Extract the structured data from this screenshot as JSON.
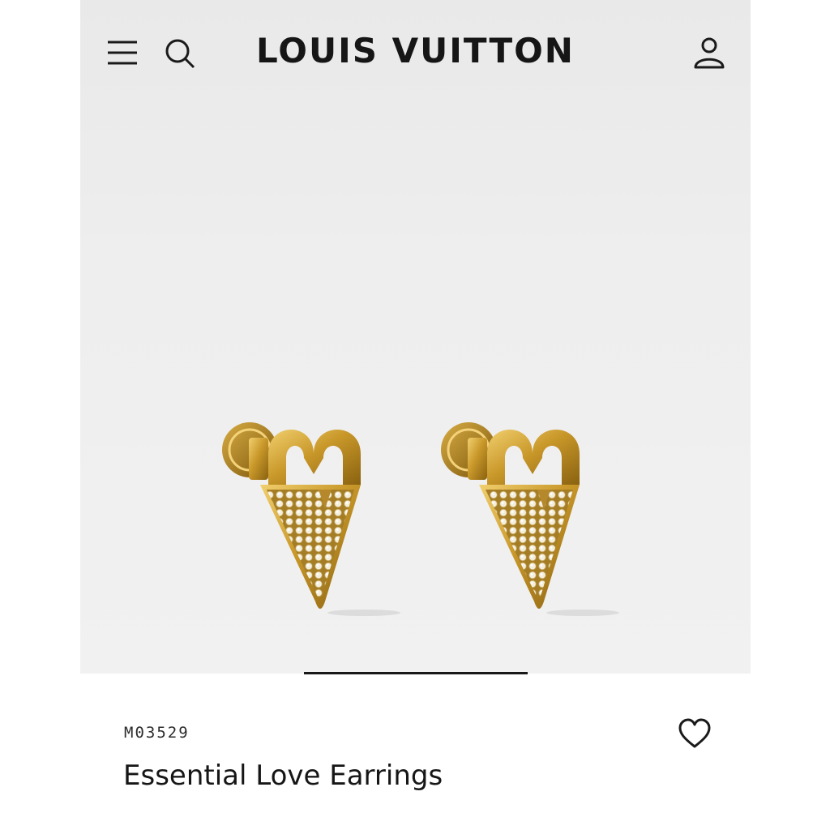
{
  "header": {
    "brand": "LOUIS VUITTON",
    "icons": [
      "menu-icon",
      "search-icon",
      "account-icon"
    ]
  },
  "product": {
    "image": "gold V-shaped earrings with pavé crystals",
    "sku": "M03529",
    "name": "Essential Love Earrings",
    "wishlist_icon": "heart-icon"
  },
  "gallery": {
    "indicator": "image-scroll-indicator"
  },
  "colors": {
    "background": "#eeeeee",
    "text": "#161616",
    "gold": "#c79a2a",
    "crystal": "#efe6cc"
  }
}
